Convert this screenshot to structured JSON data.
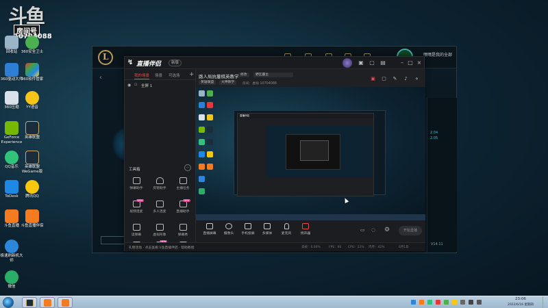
{
  "room_overlay": {
    "big_text": "斗鱼",
    "label": "房间号",
    "number": "10704088"
  },
  "desktop_icons": [
    {
      "label": "回收站",
      "color": "#9ab4c8"
    },
    {
      "label": "360安全卫士",
      "color": "#4caf50"
    },
    {
      "label": "360驱动大师",
      "color": "#2d7fd6"
    },
    {
      "label": "360软件管家",
      "color": "#e53935"
    },
    {
      "label": "360压缩",
      "color": "#d9e2ea"
    },
    {
      "label": "YY语音",
      "color": "#f5c518"
    },
    {
      "label": "GeForce\nExperience",
      "color": "#76b900"
    },
    {
      "label": "英雄联盟",
      "color": "#1b2d3a"
    },
    {
      "label": "QQ音乐",
      "color": "#31c27c"
    },
    {
      "label": "英雄联盟\nWeGame版",
      "color": "#1b2d3a"
    },
    {
      "label": "ToDesk",
      "color": "#1e88e5"
    },
    {
      "label": "腾讯QQ",
      "color": "#f9c80e"
    },
    {
      "label": "斗鱼直播",
      "color": "#f47b20"
    },
    {
      "label": "斗鱼直播伴侣",
      "color": "#f47b20"
    },
    {
      "label": "极速刷新机大师",
      "color": "#2c86d9"
    },
    {
      "label": "微信",
      "color": "#2aae67"
    }
  ],
  "lol_client": {
    "logo_letter": "L",
    "username": "嘿嘿是我的全部",
    "right_text_1": "2.04",
    "right_text_2": "2.05",
    "version": "V14.11"
  },
  "app": {
    "title": "直播伴侣",
    "version_label": "新版",
    "titlebar_icons": [
      "bell-icon",
      "gift-icon",
      "shop-icon",
      "settings-icon",
      "minimize-icon",
      "maximize-icon",
      "close-icon"
    ]
  },
  "scene_tabs": [
    {
      "label": "我的场景",
      "active": true
    },
    {
      "label": "场景",
      "active": false
    },
    {
      "label": "可选场",
      "active": false
    }
  ],
  "source": {
    "name": "全屏 1"
  },
  "tools": {
    "title": "工具箱",
    "items": [
      {
        "label": "弹幕助手",
        "badge": ""
      },
      {
        "label": "房管助手",
        "badge": ""
      },
      {
        "label": "主播任务",
        "badge": ""
      },
      {
        "label": "视频连麦",
        "badge": "NEW"
      },
      {
        "label": "多人连麦",
        "badge": ""
      },
      {
        "label": "直播助手",
        "badge": "NEW"
      },
      {
        "label": "读弹幕",
        "badge": ""
      },
      {
        "label": "虚拟形象",
        "badge": ""
      },
      {
        "label": "弹幕秀",
        "badge": ""
      },
      {
        "label": "",
        "badge": ""
      },
      {
        "label": "",
        "badge": "NEW"
      },
      {
        "label": "",
        "badge": ""
      }
    ]
  },
  "header": {
    "stream_title": "路人局抗蔓棋英教学",
    "modify": "修改",
    "category": "野区霸主",
    "game_tag": "英雄联盟",
    "chip2": "大神教学",
    "room_info": "房间：虚拟 10704088"
  },
  "controls": [
    {
      "label": "直播屏幕",
      "icon": "screen-icon"
    },
    {
      "label": "摄像头",
      "icon": "camera-icon"
    },
    {
      "label": "手机投屏",
      "icon": "phone-icon"
    },
    {
      "label": "多媒体",
      "icon": "media-icon"
    },
    {
      "label": "麦克风",
      "icon": "microphone-icon"
    },
    {
      "label": "扬声器",
      "icon": "speaker-icon"
    }
  ],
  "start_live_label": "开始直播",
  "status": {
    "notice": "礼物活动 · 点击查看斗鱼直播伴侣 · 帮助教程",
    "stats": [
      "丢帧：0.00%",
      "FPS：60",
      "CPU：11%",
      "内存：42%",
      "6月1日"
    ]
  },
  "taskbar": {
    "apps": [
      {
        "name": "lol-taskbar-app",
        "color": "#1b2d3a"
      },
      {
        "name": "douyu-taskbar-app",
        "color": "#f47b20"
      },
      {
        "name": "douyu-companion-taskbar-app",
        "color": "#f47b20"
      }
    ],
    "time": "23:06",
    "date": "2022/6/16 星期四"
  }
}
